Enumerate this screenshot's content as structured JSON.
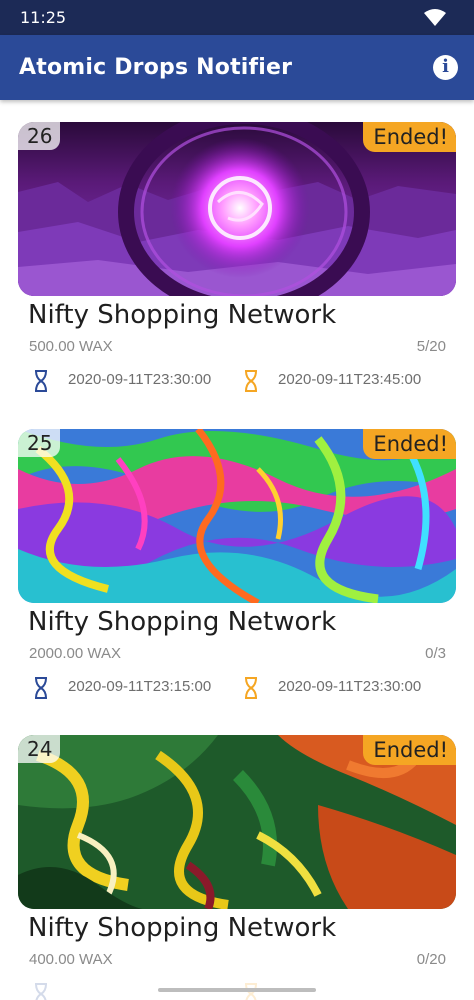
{
  "status_bar": {
    "time": "11:25"
  },
  "app_bar": {
    "title": "Atomic Drops Notifier"
  },
  "drops": [
    {
      "number": "26",
      "status": "Ended!",
      "title": "Nifty Shopping Network",
      "price": "500.00 WAX",
      "claimed": "5/20",
      "start": "2020-09-11T23:30:00",
      "end": "2020-09-11T23:45:00",
      "art": "purple-portal"
    },
    {
      "number": "25",
      "status": "Ended!",
      "title": "Nifty Shopping Network",
      "price": "2000.00 WAX",
      "claimed": "0/3",
      "start": "2020-09-11T23:15:00",
      "end": "2020-09-11T23:30:00",
      "art": "psychedelic-marble"
    },
    {
      "number": "24",
      "status": "Ended!",
      "title": "Nifty Shopping Network",
      "price": "400.00 WAX",
      "claimed": "0/20",
      "start": "",
      "end": "",
      "art": "oil-paint-swirl"
    }
  ],
  "colors": {
    "status_bar": "#1c2a56",
    "app_bar": "#2b4a98",
    "badge": "#f5a623",
    "start_icon": "#2b4a98",
    "end_icon": "#f5a623"
  }
}
